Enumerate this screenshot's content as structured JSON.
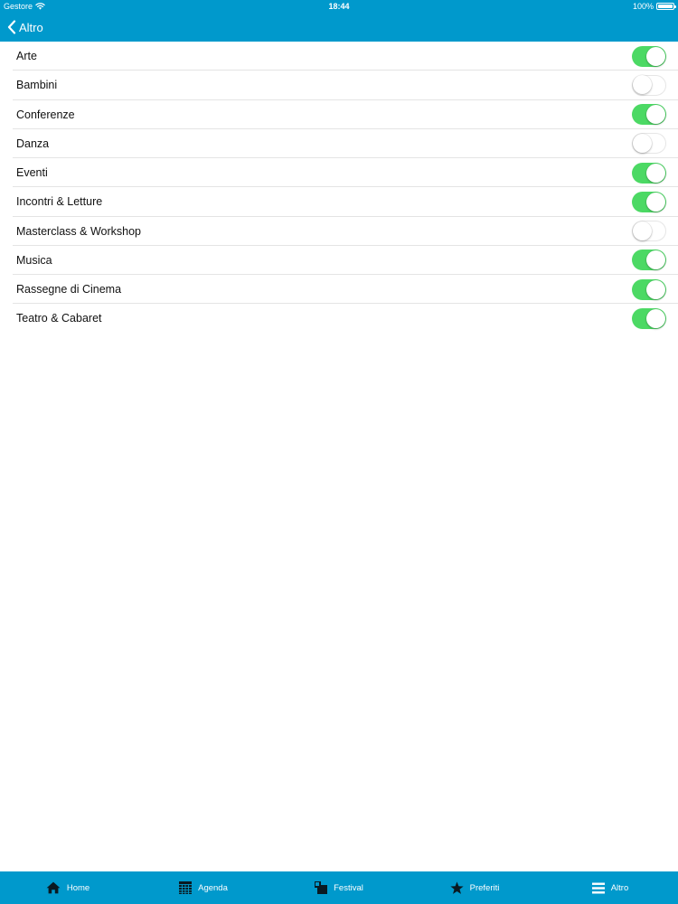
{
  "status_bar": {
    "carrier": "Gestore",
    "time": "18:44",
    "battery": "100%",
    "battery_level": 1.0
  },
  "nav": {
    "back_label": "Altro"
  },
  "categories": [
    {
      "label": "Arte",
      "enabled": true
    },
    {
      "label": "Bambini",
      "enabled": false
    },
    {
      "label": "Conferenze",
      "enabled": true
    },
    {
      "label": "Danza",
      "enabled": false
    },
    {
      "label": "Eventi",
      "enabled": true
    },
    {
      "label": "Incontri & Letture",
      "enabled": true
    },
    {
      "label": "Masterclass & Workshop",
      "enabled": false
    },
    {
      "label": "Musica",
      "enabled": true
    },
    {
      "label": "Rassegne di Cinema",
      "enabled": true
    },
    {
      "label": "Teatro & Cabaret",
      "enabled": true
    }
  ],
  "tab_bar": {
    "items": [
      {
        "label": "Home",
        "icon": "home-icon"
      },
      {
        "label": "Agenda",
        "icon": "calendar-grid-icon"
      },
      {
        "label": "Festival",
        "icon": "festival-icon"
      },
      {
        "label": "Preferiti",
        "icon": "star-icon"
      },
      {
        "label": "Altro",
        "icon": "menu-icon"
      }
    ]
  },
  "colors": {
    "header_blue": "#0099cc",
    "toggle_on": "#4cd964",
    "toggle_off_border": "#e6e6e6"
  }
}
